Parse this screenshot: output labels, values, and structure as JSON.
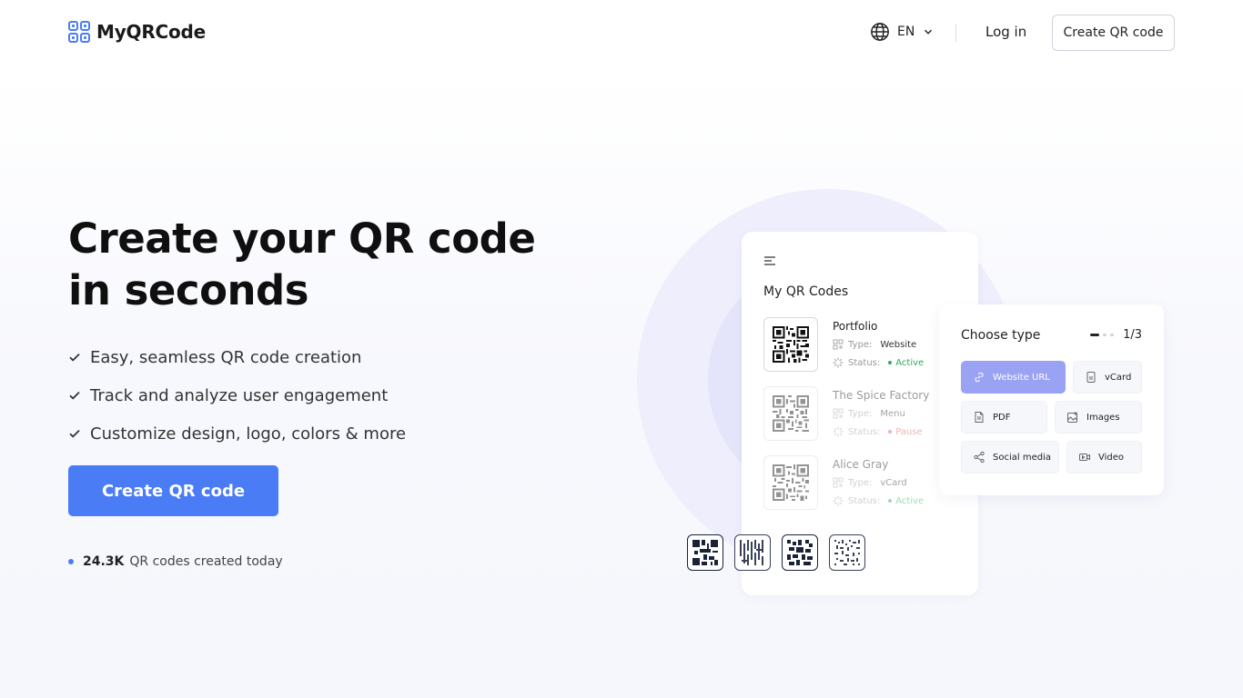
{
  "brand": {
    "name": "MyQRCode",
    "accent": "#4a7cf6"
  },
  "header": {
    "language": "EN",
    "login_label": "Log in",
    "cta_label": "Create QR code"
  },
  "hero": {
    "title_line1": "Create your QR code",
    "title_line2": "in seconds",
    "features": [
      "Easy, seamless QR code creation",
      "Track and analyze user engagement",
      "Customize design, logo, colors & more"
    ],
    "cta_label": "Create QR code",
    "stat_value": "24.3K",
    "stat_text": "QR codes created today"
  },
  "phone": {
    "title": "My QR Codes",
    "type_label": "Type:",
    "status_label": "Status:",
    "items": [
      {
        "name": "Portfolio",
        "type": "Website",
        "status": "Active"
      },
      {
        "name": "The Spice Factory",
        "type": "Menu",
        "status": "Pause"
      },
      {
        "name": "Alice Gray",
        "type": "vCard",
        "status": "Active"
      }
    ]
  },
  "chooser": {
    "title": "Choose type",
    "page": "1/3",
    "options": [
      {
        "label": "Website URL",
        "icon": "link-icon",
        "selected": true
      },
      {
        "label": "vCard",
        "icon": "contact-card-icon",
        "selected": false
      },
      {
        "label": "PDF",
        "icon": "document-icon",
        "selected": false
      },
      {
        "label": "Images",
        "icon": "image-icon",
        "selected": false
      },
      {
        "label": "Social media",
        "icon": "share-icon",
        "selected": false
      },
      {
        "label": "Video",
        "icon": "video-icon",
        "selected": false
      }
    ]
  }
}
